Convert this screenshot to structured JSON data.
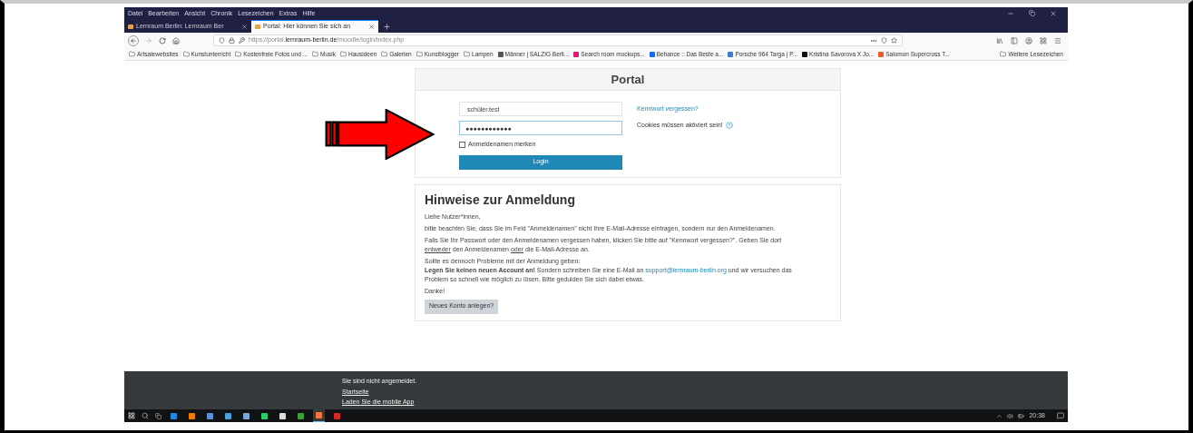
{
  "browser": {
    "menu": [
      "Datei",
      "Bearbeiten",
      "Ansicht",
      "Chronik",
      "Lesezeichen",
      "Extras",
      "Hilfe"
    ],
    "tabs": [
      {
        "title": "Lernraum Berlin: Lernraum Ber",
        "selected": false,
        "color": "#e8a33c"
      },
      {
        "title": "Portal: Hier können Sie sich an",
        "selected": true,
        "color": "#e8a33c"
      }
    ],
    "url": "https://portal.**lernraum-berlin.de**/moodle/login/index.php",
    "bookmarks": [
      {
        "kind": "folder",
        "label": "Artsalewebsites"
      },
      {
        "kind": "folder",
        "label": "Kunstunterricht"
      },
      {
        "kind": "folder",
        "label": "Kostenfreie Fotos und ..."
      },
      {
        "kind": "folder",
        "label": "Musik"
      },
      {
        "kind": "folder",
        "label": "Hausideen"
      },
      {
        "kind": "folder",
        "label": "Galerien"
      },
      {
        "kind": "folder",
        "label": "Kunstblogger"
      },
      {
        "kind": "folder",
        "label": "Lampen"
      },
      {
        "kind": "site",
        "label": "Männer | SALZIG Berli...",
        "color": "#555555"
      },
      {
        "kind": "site",
        "label": "Search room mockups...",
        "color": "#e0157a"
      },
      {
        "kind": "site",
        "label": "Behance :: Das Beste a...",
        "color": "#1769ff"
      },
      {
        "kind": "site",
        "label": "Porsche 964 Targa | P...",
        "color": "#3a7bd5"
      },
      {
        "kind": "site",
        "label": "Kristina Savorova X Jo...",
        "color": "#111111"
      },
      {
        "kind": "site",
        "label": "Salomon Supercross T...",
        "color": "#f05a28"
      }
    ],
    "more_bookmarks": "Weitere Lesezeichen"
  },
  "login": {
    "title": "Portal",
    "username": "schüler.test",
    "password": "●●●●●●●●●●●●",
    "remember": {
      "label": "Anmeldenamen merken",
      "checked": false
    },
    "button": "Login",
    "forgot_link": "Kennwort vergessen?",
    "cookies_note": "Cookies müssen aktiviert sein!"
  },
  "notes": {
    "heading": "Hinweise zur Anmeldung",
    "paragraphs": [
      [
        {
          "kind": "text",
          "text": "Liebe Nutzer*innen,"
        }
      ],
      [
        {
          "kind": "text",
          "text": "bitte beachten Sie, dass Sie im Feld \"Anmeldenamen\" nicht Ihre E-Mail-Adresse eintragen, sondern nur den Anmeldenamen."
        }
      ],
      [
        {
          "kind": "text",
          "text": "Falls Sie Ihr Passwort oder den Anmeldenamen vergessen haben, klicken Sie bitte auf \"Kennwort vergessen?\". Geben Sie dort "
        },
        {
          "kind": "underline",
          "text": "entweder"
        },
        {
          "kind": "text",
          "text": " den Anmeldenamen "
        },
        {
          "kind": "underline",
          "text": "oder"
        },
        {
          "kind": "text",
          "text": " die E-Mail-Adresse an."
        }
      ],
      [
        {
          "kind": "text",
          "text": "Sollte es dennoch Probleme mit der Anmeldung geben:"
        },
        {
          "kind": "bold",
          "text": "Legen Sie keinen neuen Account an!",
          "break_before": true
        },
        {
          "kind": "text",
          "text": " Sondern schreiben Sie eine E-Mail an "
        },
        {
          "kind": "link",
          "text": "support@lernraum-berlin.org"
        },
        {
          "kind": "text",
          "text": " und wir versuchen das Problem so schnell wie möglich zu lösen. Bitte gedulden Sie sich dabei etwas."
        }
      ],
      [
        {
          "kind": "text",
          "text": "Danke!"
        }
      ]
    ],
    "button": "Neues Konto anlegen?"
  },
  "footer": {
    "status": "Sie sind nicht angemeldet.",
    "links": [
      "Startseite",
      "Laden Sie die mobile App"
    ]
  },
  "taskbar": {
    "apps": [
      {
        "color": "#1e88e5",
        "selected": false
      },
      {
        "color": "#f57c00",
        "selected": false
      },
      {
        "color": "#5c8fd6",
        "selected": false
      },
      {
        "color": "#4aa3df",
        "selected": false
      },
      {
        "color": "#7aa7d9",
        "selected": false
      },
      {
        "color": "#25d366",
        "selected": false
      },
      {
        "color": "#dddddd",
        "selected": false
      },
      {
        "color": "#3aa13a",
        "selected": false
      },
      {
        "color": "#ff7139",
        "selected": true
      },
      {
        "color": "#d62828",
        "selected": false
      }
    ],
    "time": "20:38"
  }
}
